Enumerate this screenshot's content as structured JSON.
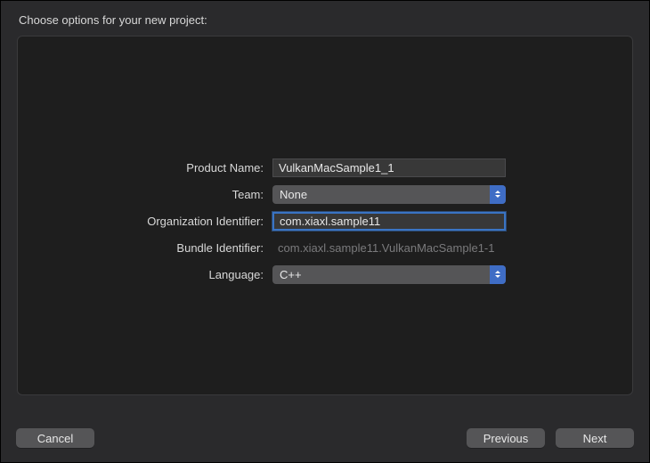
{
  "header": {
    "title": "Choose options for your new project:"
  },
  "form": {
    "productName": {
      "label": "Product Name:",
      "value": "VulkanMacSample1_1"
    },
    "team": {
      "label": "Team:",
      "value": "None"
    },
    "orgIdentifier": {
      "label": "Organization Identifier:",
      "value": "com.xiaxl.sample11"
    },
    "bundleIdentifier": {
      "label": "Bundle Identifier:",
      "value": "com.xiaxl.sample11.VulkanMacSample1-1"
    },
    "language": {
      "label": "Language:",
      "value": "C++"
    }
  },
  "footer": {
    "cancel": "Cancel",
    "previous": "Previous",
    "next": "Next"
  }
}
